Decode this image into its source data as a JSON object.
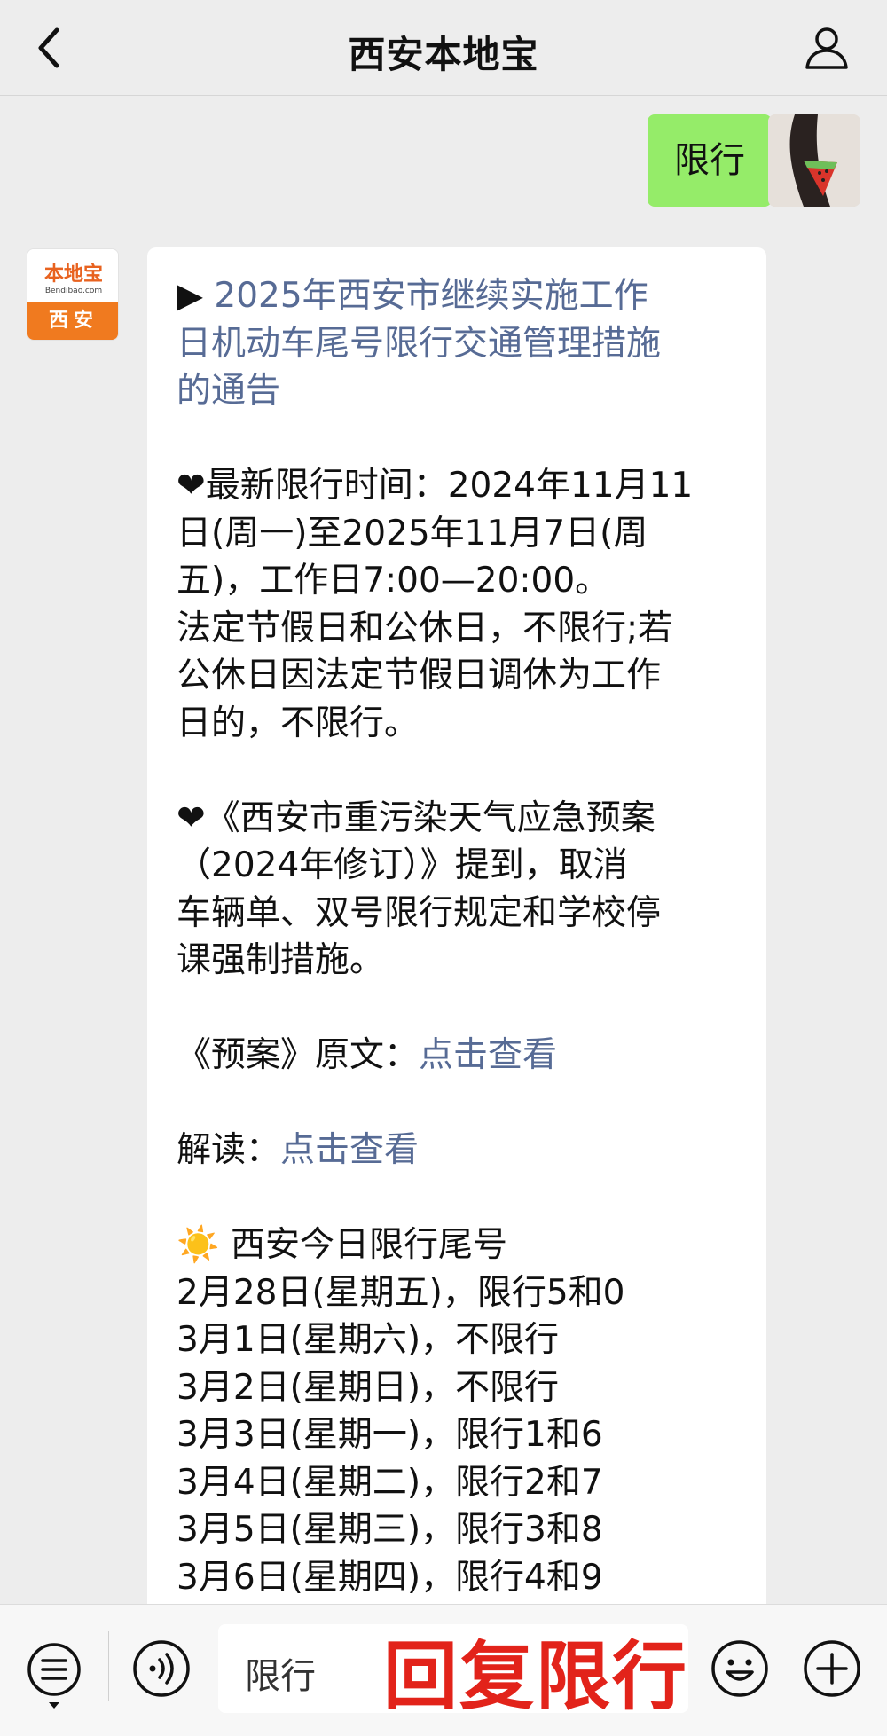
{
  "header": {
    "title": "西安本地宝"
  },
  "messages": {
    "user_text": "限行",
    "bot": {
      "avatar_logo": "本地宝",
      "avatar_url": "Bendibao.com",
      "avatar_city": "西安",
      "arrow": "▶",
      "headline_line1": "2025年西安市继续实施工作",
      "headline_line2": "日机动车尾号限行交通管理措施",
      "headline_line3": "的通告",
      "heart": "❤",
      "p1_l1": "最新限行时间：2024年11月11",
      "p1_l2": "日(周一)至2025年11月7日(周",
      "p1_l3": "五)，工作日7:00—20:00。",
      "p1_l4": "法定节假日和公休日，不限行;若",
      "p1_l5": "公休日因法定节假日调休为工作",
      "p1_l6": "日的，不限行。",
      "p2_l1": "《西安市重污染天气应急预案",
      "p2_l2": "（2024年修订）》提到，取消",
      "p2_l3": "车辆单、双号限行规定和学校停",
      "p2_l4": "课强制措施。",
      "plan_prefix": "《预案》原文：",
      "plan_link": "点击查看",
      "read_prefix": "解读：",
      "read_link": "点击查看",
      "sun": "☀️",
      "today_title": " 西安今日限行尾号",
      "schedule": [
        "2月28日(星期五)，限行5和0",
        "3月1日(星期六)，不限行",
        "3月2日(星期日)，不限行",
        "3月3日(星期一)，限行1和6",
        "3月4日(星期二)，限行2和7",
        "3月5日(星期三)，限行3和8",
        "3月6日(星期四)，限行4和9"
      ]
    }
  },
  "input": {
    "value": "限行",
    "overlay": "回复限行"
  },
  "colors": {
    "link": "#576b95",
    "user_bubble": "#95ec69",
    "overlay": "#e2231a"
  }
}
